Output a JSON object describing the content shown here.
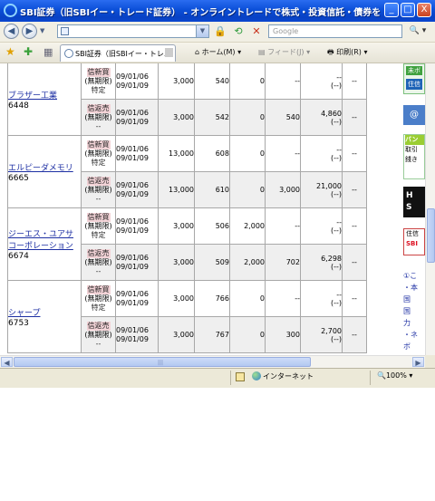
{
  "window": {
    "title": "SBI証券（旧SBIイー・トレード証券） - オンライントレードで株式・投資信託・債券を ‐ - Wind...",
    "controls": {
      "minimize": "_",
      "maximize": "□",
      "close": "X"
    }
  },
  "toolbar": {
    "search_placeholder": "Google",
    "tab_label": "SBI証券（旧SBIイー・トレ...",
    "home_label": "ホーム(M)",
    "feed_label": "フィード(J)",
    "print_label": "印刷(R)"
  },
  "stocks": [
    {
      "name": "ブラザー工業",
      "code": "6448",
      "rows": [
        {
          "type_kind": "信新買",
          "type_term": "(無期限)",
          "type_sub": "特定",
          "date1": "09/01/06",
          "date2": "09/01/09",
          "qty": "3,000",
          "price": "540",
          "v1": "0",
          "v2": "--",
          "pl": "--",
          "pl_sub": "(--)",
          "last": "--"
        },
        {
          "type_kind": "信返売",
          "type_term": "(無期限)",
          "type_sub": "--",
          "date1": "09/01/06",
          "date2": "09/01/09",
          "qty": "3,000",
          "price": "542",
          "v1": "0",
          "v2": "540",
          "pl": "4,860",
          "pl_sub": "(--)",
          "last": "--"
        }
      ]
    },
    {
      "name": "エルピーダメモリ",
      "code": "6665",
      "rows": [
        {
          "type_kind": "信新買",
          "type_term": "(無期限)",
          "type_sub": "特定",
          "date1": "09/01/06",
          "date2": "09/01/09",
          "qty": "13,000",
          "price": "608",
          "v1": "0",
          "v2": "--",
          "pl": "--",
          "pl_sub": "(--)",
          "last": "--"
        },
        {
          "type_kind": "信返売",
          "type_term": "(無期限)",
          "type_sub": "--",
          "date1": "09/01/06",
          "date2": "09/01/09",
          "qty": "13,000",
          "price": "610",
          "v1": "0",
          "v2": "3,000",
          "pl": "21,000",
          "pl_sub": "(--)",
          "last": "--"
        }
      ]
    },
    {
      "name": "ジーエス・ユアサコーポレーション",
      "name_line1": "ジーエス・ユアサ",
      "name_line2": "コーポレーション",
      "code": "6674",
      "rows": [
        {
          "type_kind": "信新買",
          "type_term": "(無期限)",
          "type_sub": "特定",
          "date1": "09/01/06",
          "date2": "09/01/09",
          "qty": "3,000",
          "price": "506",
          "v1": "2,000",
          "v2": "--",
          "pl": "--",
          "pl_sub": "(--)",
          "last": "--"
        },
        {
          "type_kind": "信返売",
          "type_term": "(無期限)",
          "type_sub": "--",
          "date1": "09/01/06",
          "date2": "09/01/09",
          "qty": "3,000",
          "price": "509",
          "v1": "2,000",
          "v2": "702",
          "pl": "6,298",
          "pl_sub": "(--)",
          "last": "--"
        }
      ]
    },
    {
      "name": "シャープ",
      "code": "6753",
      "rows": [
        {
          "type_kind": "信新買",
          "type_term": "(無期限)",
          "type_sub": "特定",
          "date1": "09/01/06",
          "date2": "09/01/09",
          "qty": "3,000",
          "price": "766",
          "v1": "0",
          "v2": "--",
          "pl": "--",
          "pl_sub": "(--)",
          "last": "--"
        },
        {
          "type_kind": "信返売",
          "type_term": "(無期限)",
          "type_sub": "--",
          "date1": "09/01/06",
          "date2": "09/01/09",
          "qty": "3,000",
          "price": "767",
          "v1": "0",
          "v2": "300",
          "pl": "2,700",
          "pl_sub": "(--)",
          "last": "--"
        }
      ]
    }
  ],
  "sidebar": {
    "item1_top": "未ボ",
    "item1_bottom": "住信",
    "item2": "@",
    "item3_head": "バン",
    "item3_line1": "取引",
    "item3_line2": "錢き",
    "item4_line1": "H",
    "item4_line2": "S",
    "item5_line1": "住信",
    "item5_line2": "SBI",
    "item6_lines": [
      "①こ",
      "・本",
      "国",
      "国",
      "力",
      "・ネ",
      "ボ",
      "・メ",
      "公"
    ]
  },
  "statusbar": {
    "zone": "インターネット",
    "zoom": "100%"
  },
  "colors": {
    "titlebar": "#0b4fd8",
    "link": "#1d2fa3",
    "type_badge": "#f2d3d7",
    "alt_row": "#efefef"
  }
}
